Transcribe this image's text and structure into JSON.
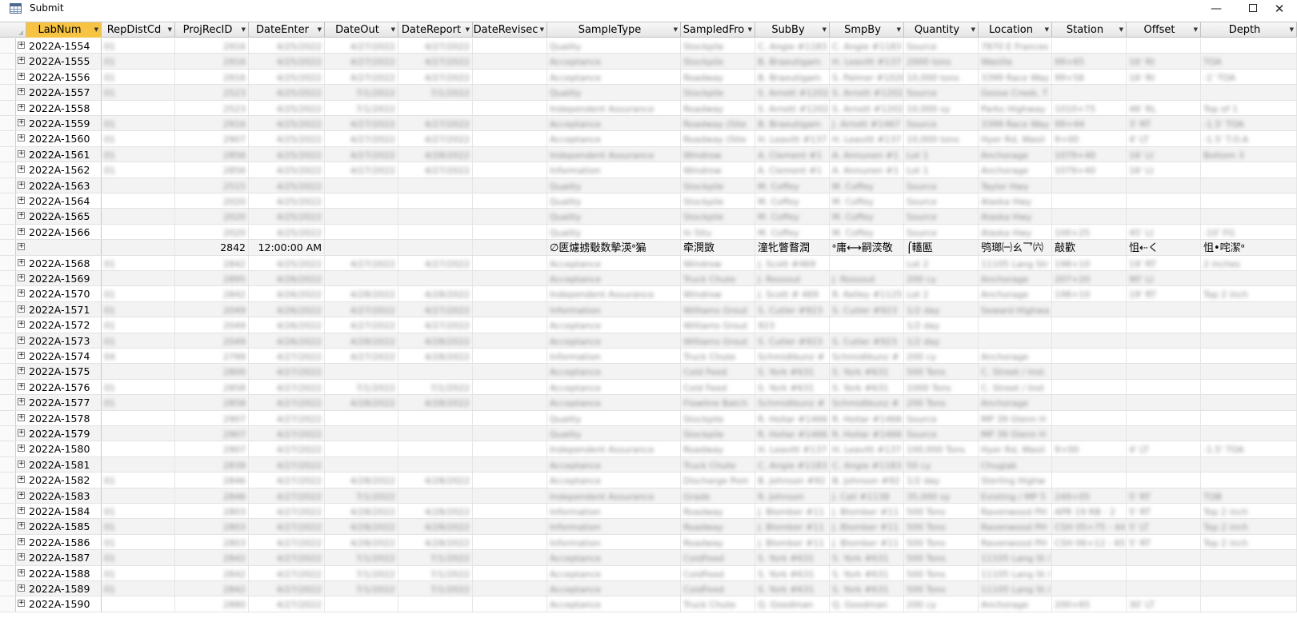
{
  "window": {
    "title": "Submit",
    "minimize_glyph": "—",
    "close_glyph": "✕"
  },
  "columns": [
    "LabNum",
    "RepDistCd",
    "ProjRecID",
    "DateEnter",
    "DateOut",
    "DateReport",
    "DateRevisec",
    "SampleType",
    "SampledFro",
    "SubBy",
    "SmpBy",
    "Quantity",
    "Location",
    "Station",
    "Offset",
    "Depth"
  ],
  "rows": [
    {
      "LabNum": "2022A-1554",
      "RepDistCd": "01",
      "ProjRecID": "2916",
      "DateEnter": "4/25/2022",
      "DateOut": "4/27/2022",
      "DateReport": "4/27/2022",
      "DateRevised": "",
      "SampleType": "Quality",
      "SampledFrom": "Stockpile",
      "SubBy": "C. Angie #1183",
      "SmpBy": "C. Angie #1183",
      "Quantity": "Source",
      "Location": "7870 E Frances",
      "Station": "",
      "Offset": "",
      "Depth": ""
    },
    {
      "LabNum": "2022A-1555",
      "RepDistCd": "01",
      "ProjRecID": "2916",
      "DateEnter": "4/25/2022",
      "DateOut": "4/27/2022",
      "DateReport": "4/27/2022",
      "DateRevised": "",
      "SampleType": "Acceptance",
      "SampledFrom": "Stockpile",
      "SubBy": "B. Braeutigam",
      "SmpBy": "H. Leavitt #137",
      "Quantity": "2000 tons",
      "Location": "Wasilla",
      "Station": "99+65",
      "Offset": "16' Rt",
      "Depth": "TOA"
    },
    {
      "LabNum": "2022A-1556",
      "RepDistCd": "01",
      "ProjRecID": "2916",
      "DateEnter": "4/25/2022",
      "DateOut": "4/27/2022",
      "DateReport": "4/27/2022",
      "DateRevised": "",
      "SampleType": "Acceptance",
      "SampledFrom": "Roadway",
      "SubBy": "B. Braeutigam",
      "SmpBy": "S. Palmer #1020",
      "Quantity": "10,000 tons",
      "Location": "3399 Race Way",
      "Station": "99+56",
      "Offset": "16' Rt",
      "Depth": "-1' TOA"
    },
    {
      "LabNum": "2022A-1557",
      "RepDistCd": "01",
      "ProjRecID": "2523",
      "DateEnter": "4/25/2022",
      "DateOut": "7/1/2022",
      "DateReport": "7/1/2022",
      "DateRevised": "",
      "SampleType": "Quality",
      "SampledFrom": "Stockpile",
      "SubBy": "S. Arnott #1202",
      "SmpBy": "S. Arnott #1202",
      "Quantity": "Source",
      "Location": "Goose Creek, T",
      "Station": "",
      "Offset": "",
      "Depth": ""
    },
    {
      "LabNum": "2022A-1558",
      "RepDistCd": "",
      "ProjRecID": "2523",
      "DateEnter": "4/25/2022",
      "DateOut": "7/1/2022",
      "DateReport": "",
      "DateRevised": "",
      "SampleType": "Independent Assurance",
      "SampledFrom": "Roadway",
      "SubBy": "S. Arnott #1202",
      "SmpBy": "S. Arnott #1202",
      "Quantity": "10,000 sy",
      "Location": "Parks Highway",
      "Station": "1010+75",
      "Offset": "46' RL",
      "Depth": "Top of 1"
    },
    {
      "LabNum": "2022A-1559",
      "RepDistCd": "01",
      "ProjRecID": "2916",
      "DateEnter": "4/25/2022",
      "DateOut": "4/27/2022",
      "DateReport": "4/27/2022",
      "DateRevised": "",
      "SampleType": "Acceptance",
      "SampledFrom": "Roadway (Site",
      "SubBy": "B. Braeutigam",
      "SmpBy": "J. Arnott #1467",
      "Quantity": "Source",
      "Location": "3399 Race Way",
      "Station": "99+44",
      "Offset": "3' RT",
      "Depth": "-1.5' TOA"
    },
    {
      "LabNum": "2022A-1560",
      "RepDistCd": "01",
      "ProjRecID": "2907",
      "DateEnter": "4/25/2022",
      "DateOut": "4/27/2022",
      "DateReport": "4/27/2022",
      "DateRevised": "",
      "SampleType": "Acceptance",
      "SampledFrom": "Roadway (Site",
      "SubBy": "H. Leavitt #137",
      "SmpBy": "H. Leavitt #137",
      "Quantity": "10,000 tons",
      "Location": "Hyer Rd, Wasil",
      "Station": "9+00",
      "Offset": "4' LT",
      "Depth": "-1.5' T.O.A"
    },
    {
      "LabNum": "2022A-1561",
      "RepDistCd": "01",
      "ProjRecID": "2856",
      "DateEnter": "4/25/2022",
      "DateOut": "4/27/2022",
      "DateReport": "4/28/2022",
      "DateRevised": "",
      "SampleType": "Independent Assurance",
      "SampledFrom": "Windrow",
      "SubBy": "A. Clement #1",
      "SmpBy": "A. Annunen #1",
      "Quantity": "Lot 1",
      "Location": "Anchorage",
      "Station": "1079+40",
      "Offset": "16' Lt",
      "Depth": "Bottom 3"
    },
    {
      "LabNum": "2022A-1562",
      "RepDistCd": "01",
      "ProjRecID": "2856",
      "DateEnter": "4/25/2022",
      "DateOut": "4/27/2022",
      "DateReport": "4/27/2022",
      "DateRevised": "",
      "SampleType": "Information",
      "SampledFrom": "Windrow",
      "SubBy": "A. Clement #1",
      "SmpBy": "A. Annunen #1",
      "Quantity": "Lot 1",
      "Location": "Anchorage",
      "Station": "1079+40",
      "Offset": "16' Lt",
      "Depth": ""
    },
    {
      "LabNum": "2022A-1563",
      "RepDistCd": "",
      "ProjRecID": "2515",
      "DateEnter": "4/25/2022",
      "DateOut": "",
      "DateReport": "",
      "DateRevised": "",
      "SampleType": "Quality",
      "SampledFrom": "Stockpile",
      "SubBy": "M. Coffey",
      "SmpBy": "M. Coffey",
      "Quantity": "Source",
      "Location": "Taylor Hwy",
      "Station": "",
      "Offset": "",
      "Depth": ""
    },
    {
      "LabNum": "2022A-1564",
      "RepDistCd": "",
      "ProjRecID": "2020",
      "DateEnter": "4/25/2022",
      "DateOut": "",
      "DateReport": "",
      "DateRevised": "",
      "SampleType": "Quality",
      "SampledFrom": "Stockpile",
      "SubBy": "M. Coffey",
      "SmpBy": "M. Coffey",
      "Quantity": "Source",
      "Location": "Alaska Hwy",
      "Station": "",
      "Offset": "",
      "Depth": ""
    },
    {
      "LabNum": "2022A-1565",
      "RepDistCd": "",
      "ProjRecID": "2020",
      "DateEnter": "4/25/2022",
      "DateOut": "",
      "DateReport": "",
      "DateRevised": "",
      "SampleType": "Quality",
      "SampledFrom": "Stockpile",
      "SubBy": "M. Coffey",
      "SmpBy": "M. Coffey",
      "Quantity": "Source",
      "Location": "Alaska Hwy",
      "Station": "",
      "Offset": "",
      "Depth": ""
    },
    {
      "LabNum": "2022A-1566",
      "RepDistCd": "",
      "ProjRecID": "2020",
      "DateEnter": "4/25/2022",
      "DateOut": "",
      "DateReport": "",
      "DateRevised": "",
      "SampleType": "Quality",
      "SampledFrom": "In Situ",
      "SubBy": "M. Coffey",
      "SmpBy": "M. Coffey",
      "Quantity": "Source",
      "Location": "Alaska Hwy",
      "Station": "100+25",
      "Offset": "45' Lt",
      "Depth": "-10' FG"
    },
    {
      "LabNum": "",
      "RepDistCd": "",
      "ProjRecID": "2842",
      "DateEnter": "12:00:00 AM",
      "DateOut": "",
      "DateReport": "",
      "DateRevised": "",
      "SampleType": "∅匧爈掳斀数摰渶ᵃ猵",
      "SampledFrom": "牵潣敳",
      "SubBy": "潼牝瞥瞀潤",
      "SmpBy": "ᵃ庸⟷嗣湙敬",
      "Quantity": "⌠䡷匭",
      "Location": "鸮瑯㈠ㄠ乛㈥",
      "Station": "敲歡",
      "Offset": "怚⇠く",
      "Depth": "怚•咤潔ᵃ"
    },
    {
      "LabNum": "2022A-1568",
      "RepDistCd": "01",
      "ProjRecID": "2842",
      "DateEnter": "4/25/2022",
      "DateOut": "4/27/2022",
      "DateReport": "4/27/2022",
      "DateRevised": "",
      "SampleType": "Acceptance",
      "SampledFrom": "Windrow",
      "SubBy": "J. Scott #469",
      "SmpBy": "",
      "Quantity": "Lot 2",
      "Location": "11105 Lang Str",
      "Station": "198+10",
      "Offset": "19' RT",
      "Depth": "2 inches"
    },
    {
      "LabNum": "2022A-1569",
      "RepDistCd": "",
      "ProjRecID": "2895",
      "DateEnter": "4/26/2022",
      "DateOut": "",
      "DateReport": "",
      "DateRevised": "",
      "SampleType": "Acceptance",
      "SampledFrom": "Truck Chute",
      "SubBy": "J. Rossout",
      "SmpBy": "J. Rossout",
      "Quantity": "200 cy",
      "Location": "Anchorage",
      "Station": "207+20",
      "Offset": "90' Lt",
      "Depth": ""
    },
    {
      "LabNum": "2022A-1570",
      "RepDistCd": "01",
      "ProjRecID": "2842",
      "DateEnter": "4/26/2022",
      "DateOut": "4/28/2022",
      "DateReport": "4/28/2022",
      "DateRevised": "",
      "SampleType": "Independent Assurance",
      "SampledFrom": "Windrow",
      "SubBy": "J. Scott # 469",
      "SmpBy": "R. Kelley #1125",
      "Quantity": "Lot 2",
      "Location": "Anchorage",
      "Station": "198+10",
      "Offset": "19' RT",
      "Depth": "Top 2 inch"
    },
    {
      "LabNum": "2022A-1571",
      "RepDistCd": "01",
      "ProjRecID": "2049",
      "DateEnter": "4/26/2022",
      "DateOut": "4/27/2022",
      "DateReport": "4/27/2022",
      "DateRevised": "",
      "SampleType": "Information",
      "SampledFrom": "Williams Grout",
      "SubBy": "S. Cutler #923",
      "SmpBy": "S. Cutler #923",
      "Quantity": "1/2 day",
      "Location": "Seward Highwa",
      "Station": "",
      "Offset": "",
      "Depth": ""
    },
    {
      "LabNum": "2022A-1572",
      "RepDistCd": "01",
      "ProjRecID": "2049",
      "DateEnter": "4/26/2022",
      "DateOut": "4/27/2022",
      "DateReport": "4/27/2022",
      "DateRevised": "",
      "SampleType": "Acceptance",
      "SampledFrom": "Williams Grout",
      "SubBy": "923",
      "SmpBy": "",
      "Quantity": "1/2 day",
      "Location": "",
      "Station": "",
      "Offset": "",
      "Depth": ""
    },
    {
      "LabNum": "2022A-1573",
      "RepDistCd": "01",
      "ProjRecID": "2049",
      "DateEnter": "4/26/2022",
      "DateOut": "4/28/2022",
      "DateReport": "4/28/2022",
      "DateRevised": "",
      "SampleType": "Acceptance",
      "SampledFrom": "Williams Grout",
      "SubBy": "S. Cutler #923",
      "SmpBy": "S. Cutler #923",
      "Quantity": "1/2 day",
      "Location": "",
      "Station": "",
      "Offset": "",
      "Depth": ""
    },
    {
      "LabNum": "2022A-1574",
      "RepDistCd": "04",
      "ProjRecID": "2799",
      "DateEnter": "4/27/2022",
      "DateOut": "4/27/2022",
      "DateReport": "4/28/2022",
      "DateRevised": "",
      "SampleType": "Information",
      "SampledFrom": "Truck Chute",
      "SubBy": "Schmidtkunz #",
      "SmpBy": "Schmidtkunz #",
      "Quantity": "200 cy",
      "Location": "Anchorage",
      "Station": "",
      "Offset": "",
      "Depth": ""
    },
    {
      "LabNum": "2022A-1575",
      "RepDistCd": "",
      "ProjRecID": "2800",
      "DateEnter": "4/27/2022",
      "DateOut": "",
      "DateReport": "",
      "DateRevised": "",
      "SampleType": "Acceptance",
      "SampledFrom": "Cold Feed",
      "SubBy": "S. York #631",
      "SmpBy": "S. York #631",
      "Quantity": "500 Tons",
      "Location": "C. Street / Inst",
      "Station": "",
      "Offset": "",
      "Depth": ""
    },
    {
      "LabNum": "2022A-1576",
      "RepDistCd": "01",
      "ProjRecID": "2858",
      "DateEnter": "4/27/2022",
      "DateOut": "7/1/2022",
      "DateReport": "7/1/2022",
      "DateRevised": "",
      "SampleType": "Acceptance",
      "SampledFrom": "Cold Feed",
      "SubBy": "S. York #631",
      "SmpBy": "S. York #631",
      "Quantity": "1000 Tons",
      "Location": "C. Street / Inst",
      "Station": "",
      "Offset": "",
      "Depth": ""
    },
    {
      "LabNum": "2022A-1577",
      "RepDistCd": "01",
      "ProjRecID": "2858",
      "DateEnter": "4/27/2022",
      "DateOut": "4/28/2022",
      "DateReport": "4/28/2022",
      "DateRevised": "",
      "SampleType": "Acceptance",
      "SampledFrom": "Flowline Batch",
      "SubBy": "Schmidtkunz #",
      "SmpBy": "Schmidtkunz #",
      "Quantity": "200 Tons",
      "Location": "Anchorage",
      "Station": "",
      "Offset": "",
      "Depth": ""
    },
    {
      "LabNum": "2022A-1578",
      "RepDistCd": "",
      "ProjRecID": "2907",
      "DateEnter": "4/27/2022",
      "DateOut": "",
      "DateReport": "",
      "DateRevised": "",
      "SampleType": "Quality",
      "SampledFrom": "Stockpile",
      "SubBy": "R. Hollar #1466",
      "SmpBy": "R. Hollar #1466",
      "Quantity": "Source",
      "Location": "MP 39 Glenn H",
      "Station": "",
      "Offset": "",
      "Depth": ""
    },
    {
      "LabNum": "2022A-1579",
      "RepDistCd": "",
      "ProjRecID": "2907",
      "DateEnter": "4/27/2022",
      "DateOut": "",
      "DateReport": "",
      "DateRevised": "",
      "SampleType": "Quality",
      "SampledFrom": "Stockpile",
      "SubBy": "R. Hollar #1466",
      "SmpBy": "R. Hollar #1466",
      "Quantity": "Source",
      "Location": "MP 39 Glenn H",
      "Station": "",
      "Offset": "",
      "Depth": ""
    },
    {
      "LabNum": "2022A-1580",
      "RepDistCd": "",
      "ProjRecID": "2907",
      "DateEnter": "4/27/2022",
      "DateOut": "",
      "DateReport": "",
      "DateRevised": "",
      "SampleType": "Independent Assurance",
      "SampledFrom": "Roadway",
      "SubBy": "H. Leavitt #137",
      "SmpBy": "H. Leavitt #137",
      "Quantity": "100,000 Tons",
      "Location": "Hyer Rd, Wasil",
      "Station": "9+00",
      "Offset": "4' LT",
      "Depth": "-1.5' TOA"
    },
    {
      "LabNum": "2022A-1581",
      "RepDistCd": "",
      "ProjRecID": "2839",
      "DateEnter": "4/27/2022",
      "DateOut": "",
      "DateReport": "",
      "DateRevised": "",
      "SampleType": "Acceptance",
      "SampledFrom": "Truck Chute",
      "SubBy": "C. Angie #1183",
      "SmpBy": "C. Angie #1183",
      "Quantity": "50 cy",
      "Location": "Chugiak",
      "Station": "",
      "Offset": "",
      "Depth": ""
    },
    {
      "LabNum": "2022A-1582",
      "RepDistCd": "01",
      "ProjRecID": "2846",
      "DateEnter": "4/27/2022",
      "DateOut": "4/28/2022",
      "DateReport": "4/28/2022",
      "DateRevised": "",
      "SampleType": "Acceptance",
      "SampledFrom": "Discharge Poin",
      "SubBy": "B. Johnson #92",
      "SmpBy": "B. Johnson #92",
      "Quantity": "1/2 day",
      "Location": "Sterling Highw",
      "Station": "",
      "Offset": "",
      "Depth": ""
    },
    {
      "LabNum": "2022A-1583",
      "RepDistCd": "",
      "ProjRecID": "2846",
      "DateEnter": "4/27/2022",
      "DateOut": "7/1/2022",
      "DateReport": "",
      "DateRevised": "",
      "SampleType": "Independent Assurance",
      "SampledFrom": "Grade",
      "SubBy": "R. Johnson",
      "SmpBy": "J. Call #1138",
      "Quantity": "35,000 sy",
      "Location": "Existing / MP 5",
      "Station": "249+05",
      "Offset": "5' RT",
      "Depth": "TOB"
    },
    {
      "LabNum": "2022A-1584",
      "RepDistCd": "01",
      "ProjRecID": "2803",
      "DateEnter": "4/27/2022",
      "DateOut": "4/28/2022",
      "DateReport": "4/28/2022",
      "DateRevised": "",
      "SampleType": "Information",
      "SampledFrom": "Roadway",
      "SubBy": "J. Blomber #11",
      "SmpBy": "J. Blomber #11",
      "Quantity": "500 Tons",
      "Location": "Ravenwood PH",
      "Station": "APR 19 RB - 2",
      "Offset": "5' RT",
      "Depth": "Top 2 inch"
    },
    {
      "LabNum": "2022A-1585",
      "RepDistCd": "01",
      "ProjRecID": "2803",
      "DateEnter": "4/27/2022",
      "DateOut": "4/28/2022",
      "DateReport": "4/28/2022",
      "DateRevised": "",
      "SampleType": "Information",
      "SampledFrom": "Roadway",
      "SubBy": "J. Blomber #11",
      "SmpBy": "J. Blomber #11",
      "Quantity": "500 Tons",
      "Location": "Ravenwood PH",
      "Station": "CSH 05+75 - 44",
      "Offset": "5' LT",
      "Depth": "Top 2 inch"
    },
    {
      "LabNum": "2022A-1586",
      "RepDistCd": "01",
      "ProjRecID": "2803",
      "DateEnter": "4/27/2022",
      "DateOut": "4/28/2022",
      "DateReport": "4/28/2022",
      "DateRevised": "",
      "SampleType": "Information",
      "SampledFrom": "Roadway",
      "SubBy": "J. Blomber #11",
      "SmpBy": "J. Blomber #11",
      "Quantity": "500 Tons",
      "Location": "Ravenwood PH",
      "Station": "CSH 06+12 - 65",
      "Offset": "5' RT",
      "Depth": "Top 2 inch"
    },
    {
      "LabNum": "2022A-1587",
      "RepDistCd": "01",
      "ProjRecID": "2842",
      "DateEnter": "4/27/2022",
      "DateOut": "7/1/2022",
      "DateReport": "7/1/2022",
      "DateRevised": "",
      "SampleType": "Acceptance",
      "SampledFrom": "ColdFeed",
      "SubBy": "S. York #631",
      "SmpBy": "S. York #631",
      "Quantity": "500 Tons",
      "Location": "11105 Lang St /",
      "Station": "",
      "Offset": "",
      "Depth": ""
    },
    {
      "LabNum": "2022A-1588",
      "RepDistCd": "01",
      "ProjRecID": "2842",
      "DateEnter": "4/27/2022",
      "DateOut": "7/1/2022",
      "DateReport": "7/1/2022",
      "DateRevised": "",
      "SampleType": "Acceptance",
      "SampledFrom": "ColdFeed",
      "SubBy": "S. York #631",
      "SmpBy": "S. York #631",
      "Quantity": "500 Tons",
      "Location": "11105 Lang St /",
      "Station": "",
      "Offset": "",
      "Depth": ""
    },
    {
      "LabNum": "2022A-1589",
      "RepDistCd": "01",
      "ProjRecID": "2842",
      "DateEnter": "4/27/2022",
      "DateOut": "7/1/2022",
      "DateReport": "7/1/2022",
      "DateRevised": "",
      "SampleType": "Acceptance",
      "SampledFrom": "ColdFeed",
      "SubBy": "S. York #631",
      "SmpBy": "S. York #631",
      "Quantity": "500 Tons",
      "Location": "11105 Lang St /",
      "Station": "",
      "Offset": "",
      "Depth": ""
    },
    {
      "LabNum": "2022A-1590",
      "RepDistCd": "",
      "ProjRecID": "2880",
      "DateEnter": "4/27/2022",
      "DateOut": "",
      "DateReport": "",
      "DateRevised": "",
      "SampleType": "Acceptance",
      "SampledFrom": "Truck Chute",
      "SubBy": "Q. Goodman",
      "SmpBy": "Q. Goodman",
      "Quantity": "200 cy",
      "Location": "Anchorage",
      "Station": "200+65",
      "Offset": "30' LT",
      "Depth": ""
    }
  ],
  "garbled_row_index": 13,
  "accent_color": "#f6c342"
}
